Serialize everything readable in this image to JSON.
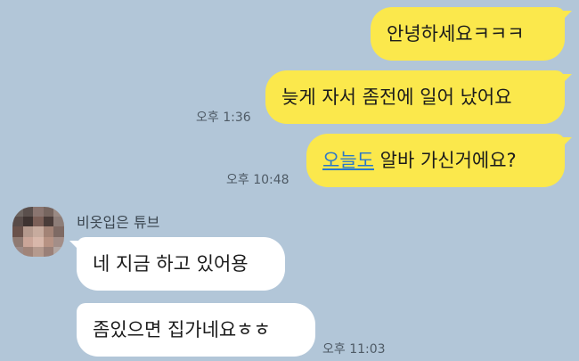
{
  "messages_sent": [
    {
      "text": "안녕하세요ㅋㅋㅋ"
    },
    {
      "text": "늦게 자서 좀전에 일어 났어요",
      "time": "오후 1:36"
    },
    {
      "link_text": "오늘도",
      "rest_text": " 알바 가신거에요?",
      "time": "오후 10:48"
    }
  ],
  "contact": {
    "name": "비옷입은 튜브"
  },
  "messages_received": [
    {
      "text": "네 지금 하고 있어용"
    },
    {
      "text": "좀있으면 집가네요ㅎㅎ",
      "time": "오후 11:03"
    }
  ],
  "colors": {
    "background": "#b2c6d8",
    "my_bubble": "#fbe84c",
    "their_bubble": "#ffffff",
    "link": "#2b78c9"
  },
  "icons": {
    "avatar": "pixelated-profile-photo"
  }
}
